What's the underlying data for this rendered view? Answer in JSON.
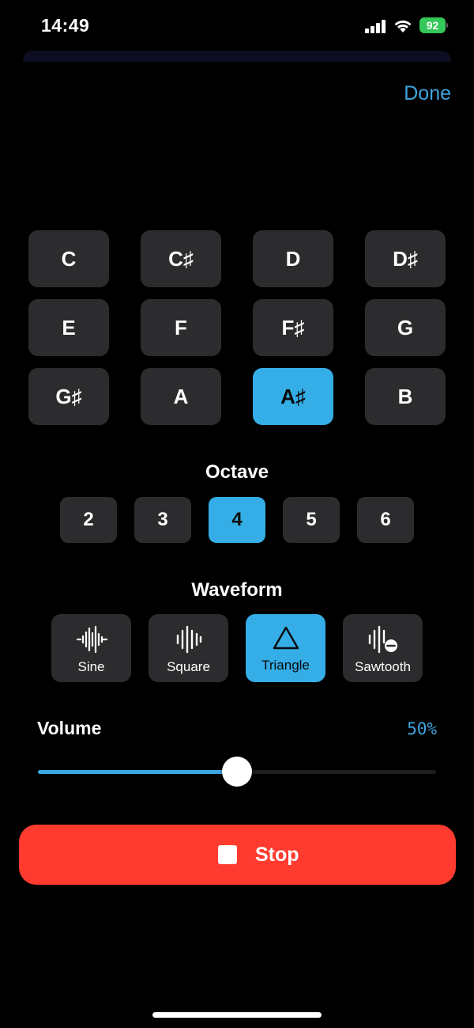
{
  "status_bar": {
    "time": "14:49",
    "battery": "92",
    "battery_color": "#34c759"
  },
  "header": {
    "done_label": "Done"
  },
  "notes": {
    "keys": [
      "C",
      "C♯",
      "D",
      "D♯",
      "E",
      "F",
      "F♯",
      "G",
      "G♯",
      "A",
      "A♯",
      "B"
    ],
    "selected": "A♯"
  },
  "octave": {
    "title": "Octave",
    "options": [
      "2",
      "3",
      "4",
      "5",
      "6"
    ],
    "selected": "4"
  },
  "waveform": {
    "title": "Waveform",
    "options": [
      {
        "label": "Sine",
        "icon": "waveform-icon"
      },
      {
        "label": "Square",
        "icon": "waveform-bars-icon"
      },
      {
        "label": "Triangle",
        "icon": "triangle-icon"
      },
      {
        "label": "Sawtooth",
        "icon": "waveform-minus-icon"
      }
    ],
    "selected": "Triangle"
  },
  "volume": {
    "label": "Volume",
    "value_text": "50%",
    "level": 0.5
  },
  "stop_button": {
    "label": "Stop"
  },
  "colors": {
    "accent": "#35ade6",
    "button_bg": "#2c2c2e",
    "stop": "#ff3b30"
  }
}
